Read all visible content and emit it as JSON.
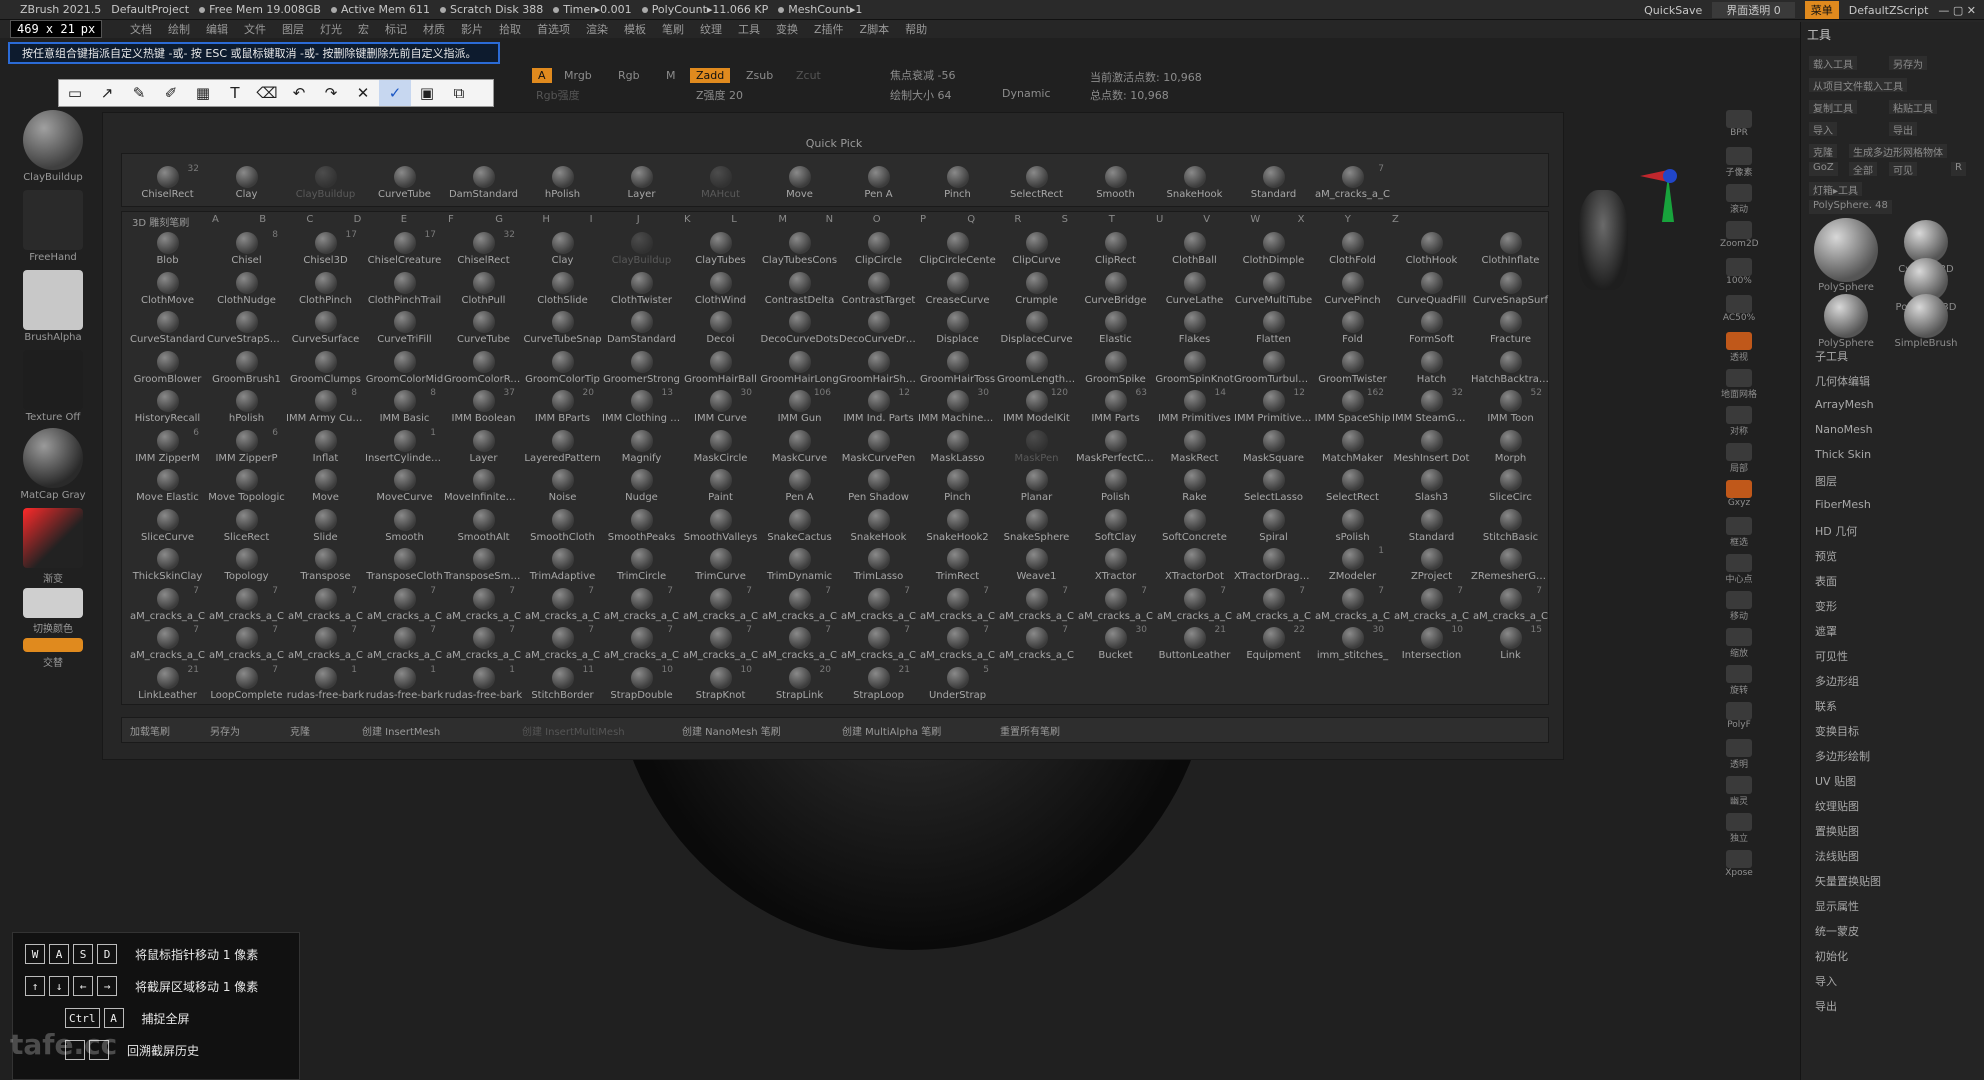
{
  "titlebar": {
    "app": "ZBrush 2021.5",
    "project": "DefaultProject",
    "stats": [
      "Free Mem 19.008GB",
      "Active Mem 611",
      "Scratch Disk 388",
      "Timer▸0.001",
      "PolyCount▸11.066 KP",
      "MeshCount▸1"
    ],
    "quicksave": "QuickSave",
    "transparency": "界面透明 0",
    "menu_btn": "菜单",
    "script": "DefaultZScript"
  },
  "menubar": {
    "items": [
      "文档",
      "绘制",
      "编辑",
      "文件",
      "图层",
      "灯光",
      "宏",
      "标记",
      "材质",
      "影片",
      "拾取",
      "首选项",
      "渲染",
      "模板",
      "笔刷",
      "纹理",
      "工具",
      "变换",
      "Z插件",
      "Z脚本",
      "帮助"
    ]
  },
  "size_readout": {
    "value": "469 x 21",
    "unit": "px"
  },
  "hint_bar": {
    "text": "按任意组合键指派自定义热键 -或- 按 ESC 或鼠标键取消 -或- 按删除键删除先前自定义指派。"
  },
  "snip_toolbar": {
    "buttons": [
      {
        "icon": "rectangle-icon",
        "glyph": "▭"
      },
      {
        "icon": "line-icon",
        "glyph": "↗"
      },
      {
        "icon": "pen-icon",
        "glyph": "✎"
      },
      {
        "icon": "highlighter-icon",
        "glyph": "✐"
      },
      {
        "icon": "mosaic-icon",
        "glyph": "▦"
      },
      {
        "icon": "text-icon",
        "glyph": "T"
      },
      {
        "icon": "eraser-icon",
        "glyph": "⌫"
      },
      {
        "icon": "undo-icon",
        "glyph": "↶"
      },
      {
        "icon": "redo-icon",
        "glyph": "↷"
      },
      {
        "icon": "close-icon",
        "glyph": "✕"
      },
      {
        "icon": "pin-icon",
        "glyph": "✓"
      },
      {
        "icon": "save-icon",
        "glyph": "▣"
      },
      {
        "icon": "copy-icon",
        "glyph": "⧉"
      }
    ]
  },
  "left_shelf": {
    "items": [
      "ClayBuildup",
      "FreeHand",
      "BrushAlpha",
      "Texture Off",
      "MatCap Gray",
      "渐变",
      "切换颜色",
      "交替"
    ]
  },
  "top_strip": {
    "a": "A",
    "mrgb": "Mrgb",
    "rgb": "Rgb",
    "m": "M",
    "zadd": "Zadd",
    "zsub": "Zsub",
    "zcut": "Zcut",
    "rgb_strength": "Rgb强度",
    "z_strength": "Z强度 20",
    "focal_label": "焦点衰减 -56",
    "draw_size": "绘制大小 64",
    "dynamic": "Dynamic",
    "active_points": "当前激活点数: 10,968",
    "total_points": "总点数: 10,968"
  },
  "brush_panel": {
    "quick_pick_title": "Quick Pick",
    "quick_pick": [
      {
        "name": "ChiselRect",
        "count": "32"
      },
      {
        "name": "Clay"
      },
      {
        "name": "ClayBuildup",
        "dim": true
      },
      {
        "name": "CurveTube"
      },
      {
        "name": "DamStandard"
      },
      {
        "name": "hPolish"
      },
      {
        "name": "Layer"
      },
      {
        "name": "MAHcut",
        "dim": true
      },
      {
        "name": "Move"
      },
      {
        "name": "Pen A"
      },
      {
        "name": "Pinch"
      },
      {
        "name": "SelectRect"
      },
      {
        "name": "Smooth"
      },
      {
        "name": "SnakeHook"
      },
      {
        "name": "Standard"
      },
      {
        "name": "aM_cracks_a_C",
        "count": "7"
      }
    ],
    "section_label": "3D 雕刻笔刷",
    "alphabet": [
      "A",
      "B",
      "C",
      "D",
      "E",
      "F",
      "G",
      "H",
      "I",
      "J",
      "K",
      "L",
      "M",
      "N",
      "O",
      "P",
      "Q",
      "R",
      "S",
      "T",
      "U",
      "V",
      "W",
      "X",
      "Y",
      "Z"
    ],
    "rows": [
      [
        {
          "name": "Blob"
        },
        {
          "name": "Chisel",
          "count": "8"
        },
        {
          "name": "Chisel3D",
          "count": "17"
        },
        {
          "name": "ChiselCreature",
          "count": "17"
        },
        {
          "name": "ChiselRect",
          "count": "32"
        },
        {
          "name": "Clay"
        },
        {
          "name": "ClayBuildup",
          "dim": true
        },
        {
          "name": "ClayTubes"
        },
        {
          "name": "ClayTubesCons"
        },
        {
          "name": "ClipCircle"
        },
        {
          "name": "ClipCircleCente"
        },
        {
          "name": "ClipCurve"
        },
        {
          "name": "ClipRect"
        },
        {
          "name": "ClothBall"
        },
        {
          "name": "ClothDimple"
        },
        {
          "name": "ClothFold"
        },
        {
          "name": "ClothHook"
        },
        {
          "name": "ClothInflate"
        }
      ],
      [
        {
          "name": "ClothMove"
        },
        {
          "name": "ClothNudge"
        },
        {
          "name": "ClothPinch"
        },
        {
          "name": "ClothPinchTrail"
        },
        {
          "name": "ClothPull"
        },
        {
          "name": "ClothSlide"
        },
        {
          "name": "ClothTwister"
        },
        {
          "name": "ClothWind"
        },
        {
          "name": "ContrastDelta"
        },
        {
          "name": "ContrastTarget"
        },
        {
          "name": "CreaseCurve"
        },
        {
          "name": "Crumple"
        },
        {
          "name": "CurveBridge"
        },
        {
          "name": "CurveLathe"
        },
        {
          "name": "CurveMultiTube"
        },
        {
          "name": "CurvePinch"
        },
        {
          "name": "CurveQuadFill"
        },
        {
          "name": "CurveSnapSurf"
        }
      ],
      [
        {
          "name": "CurveStandard"
        },
        {
          "name": "CurveStrapSnap"
        },
        {
          "name": "CurveSurface"
        },
        {
          "name": "CurveTriFill"
        },
        {
          "name": "CurveTube"
        },
        {
          "name": "CurveTubeSnap"
        },
        {
          "name": "DamStandard"
        },
        {
          "name": "Decoi"
        },
        {
          "name": "DecoCurveDots"
        },
        {
          "name": "DecoCurveDrag"
        },
        {
          "name": "Displace"
        },
        {
          "name": "DisplaceCurve"
        },
        {
          "name": "Elastic"
        },
        {
          "name": "Flakes"
        },
        {
          "name": "Flatten"
        },
        {
          "name": "Fold"
        },
        {
          "name": "FormSoft"
        },
        {
          "name": "Fracture"
        }
      ],
      [
        {
          "name": "GroomBlower"
        },
        {
          "name": "GroomBrush1"
        },
        {
          "name": "GroomClumps"
        },
        {
          "name": "GroomColorMid"
        },
        {
          "name": "GroomColorRoot"
        },
        {
          "name": "GroomColorTip"
        },
        {
          "name": "GroomerStrong"
        },
        {
          "name": "GroomHairBall"
        },
        {
          "name": "GroomHairLong"
        },
        {
          "name": "GroomHairShort"
        },
        {
          "name": "GroomHairToss"
        },
        {
          "name": "GroomLengthen"
        },
        {
          "name": "GroomSpike"
        },
        {
          "name": "GroomSpinKnot"
        },
        {
          "name": "GroomTurbulence"
        },
        {
          "name": "GroomTwister"
        },
        {
          "name": "Hatch"
        },
        {
          "name": "HatchBacktrack"
        }
      ],
      [
        {
          "name": "HistoryRecall"
        },
        {
          "name": "hPolish"
        },
        {
          "name": "IMM Army Curve",
          "count": "8"
        },
        {
          "name": "IMM Basic",
          "count": "8"
        },
        {
          "name": "IMM Boolean",
          "count": "37"
        },
        {
          "name": "IMM BParts",
          "count": "20"
        },
        {
          "name": "IMM Clothing HD",
          "count": "13"
        },
        {
          "name": "IMM Curve",
          "count": "30"
        },
        {
          "name": "IMM Gun",
          "count": "106"
        },
        {
          "name": "IMM Ind. Parts",
          "count": "12"
        },
        {
          "name": "IMM MachineParts",
          "count": "30"
        },
        {
          "name": "IMM ModelKit",
          "count": "120"
        },
        {
          "name": "IMM Parts",
          "count": "63"
        },
        {
          "name": "IMM Primitives",
          "count": "14"
        },
        {
          "name": "IMM PrimitivesHi",
          "count": "12"
        },
        {
          "name": "IMM SpaceShip",
          "count": "162"
        },
        {
          "name": "IMM SteamGears",
          "count": "32"
        },
        {
          "name": "IMM Toon",
          "count": "52"
        }
      ],
      [
        {
          "name": "IMM ZipperM",
          "count": "6"
        },
        {
          "name": "IMM ZipperP",
          "count": "6"
        },
        {
          "name": "Inflat"
        },
        {
          "name": "InsertCylinderExt",
          "count": "1"
        },
        {
          "name": "Layer"
        },
        {
          "name": "LayeredPattern"
        },
        {
          "name": "Magnify"
        },
        {
          "name": "MaskCircle"
        },
        {
          "name": "MaskCurve"
        },
        {
          "name": "MaskCurvePen"
        },
        {
          "name": "MaskLasso"
        },
        {
          "name": "MaskPen",
          "dim": true
        },
        {
          "name": "MaskPerfectCircle"
        },
        {
          "name": "MaskRect"
        },
        {
          "name": "MaskSquare"
        },
        {
          "name": "MatchMaker"
        },
        {
          "name": "MeshInsert Dot"
        },
        {
          "name": "Morph"
        }
      ],
      [
        {
          "name": "Move Elastic"
        },
        {
          "name": "Move Topologic"
        },
        {
          "name": "Move"
        },
        {
          "name": "MoveCurve"
        },
        {
          "name": "MoveInfiniteDepth"
        },
        {
          "name": "Noise"
        },
        {
          "name": "Nudge"
        },
        {
          "name": "Paint"
        },
        {
          "name": "Pen A"
        },
        {
          "name": "Pen Shadow"
        },
        {
          "name": "Pinch"
        },
        {
          "name": "Planar"
        },
        {
          "name": "Polish"
        },
        {
          "name": "Rake"
        },
        {
          "name": "SelectLasso"
        },
        {
          "name": "SelectRect"
        },
        {
          "name": "Slash3"
        },
        {
          "name": "SliceCirc"
        }
      ],
      [
        {
          "name": "SliceCurve"
        },
        {
          "name": "SliceRect"
        },
        {
          "name": "Slide"
        },
        {
          "name": "Smooth"
        },
        {
          "name": "SmoothAlt"
        },
        {
          "name": "SmoothCloth"
        },
        {
          "name": "SmoothPeaks"
        },
        {
          "name": "SmoothValleys"
        },
        {
          "name": "SnakeCactus"
        },
        {
          "name": "SnakeHook"
        },
        {
          "name": "SnakeHook2"
        },
        {
          "name": "SnakeSphere"
        },
        {
          "name": "SoftClay"
        },
        {
          "name": "SoftConcrete"
        },
        {
          "name": "Spiral"
        },
        {
          "name": "sPolish"
        },
        {
          "name": "Standard"
        },
        {
          "name": "StitchBasic"
        }
      ],
      [
        {
          "name": "ThickSkinClay"
        },
        {
          "name": "Topology"
        },
        {
          "name": "Transpose"
        },
        {
          "name": "TransposeCloth"
        },
        {
          "name": "TransposeSmart"
        },
        {
          "name": "TrimAdaptive"
        },
        {
          "name": "TrimCircle"
        },
        {
          "name": "TrimCurve"
        },
        {
          "name": "TrimDynamic"
        },
        {
          "name": "TrimLasso"
        },
        {
          "name": "TrimRect"
        },
        {
          "name": "Weave1"
        },
        {
          "name": "XTractor"
        },
        {
          "name": "XTractorDot"
        },
        {
          "name": "XTractorDragRect"
        },
        {
          "name": "ZModeler",
          "count": "1"
        },
        {
          "name": "ZProject"
        },
        {
          "name": "ZRemesherGuides"
        }
      ],
      [
        {
          "name": "aM_cracks_a_C",
          "count": "7"
        },
        {
          "name": "aM_cracks_a_C",
          "count": "7"
        },
        {
          "name": "aM_cracks_a_C",
          "count": "7"
        },
        {
          "name": "aM_cracks_a_C",
          "count": "7"
        },
        {
          "name": "aM_cracks_a_C",
          "count": "7"
        },
        {
          "name": "aM_cracks_a_C",
          "count": "7"
        },
        {
          "name": "aM_cracks_a_C",
          "count": "7"
        },
        {
          "name": "aM_cracks_a_C",
          "count": "7"
        },
        {
          "name": "aM_cracks_a_C",
          "count": "7"
        },
        {
          "name": "aM_cracks_a_C",
          "count": "7"
        },
        {
          "name": "aM_cracks_a_C",
          "count": "7"
        },
        {
          "name": "aM_cracks_a_C",
          "count": "7"
        },
        {
          "name": "aM_cracks_a_C",
          "count": "7"
        },
        {
          "name": "aM_cracks_a_C",
          "count": "7"
        },
        {
          "name": "aM_cracks_a_C",
          "count": "7"
        },
        {
          "name": "aM_cracks_a_C",
          "count": "7"
        },
        {
          "name": "aM_cracks_a_C",
          "count": "7"
        },
        {
          "name": "aM_cracks_a_C",
          "count": "7"
        }
      ],
      [
        {
          "name": "aM_cracks_a_C",
          "count": "7"
        },
        {
          "name": "aM_cracks_a_C",
          "count": "7"
        },
        {
          "name": "aM_cracks_a_C",
          "count": "7"
        },
        {
          "name": "aM_cracks_a_C",
          "count": "7"
        },
        {
          "name": "aM_cracks_a_C",
          "count": "7"
        },
        {
          "name": "aM_cracks_a_C",
          "count": "7"
        },
        {
          "name": "aM_cracks_a_C",
          "count": "7"
        },
        {
          "name": "aM_cracks_a_C",
          "count": "7"
        },
        {
          "name": "aM_cracks_a_C",
          "count": "7"
        },
        {
          "name": "aM_cracks_a_C",
          "count": "7"
        },
        {
          "name": "aM_cracks_a_C",
          "count": "7"
        },
        {
          "name": "aM_cracks_a_C",
          "count": "7"
        },
        {
          "name": "Bucket",
          "count": "30"
        },
        {
          "name": "ButtonLeather",
          "count": "21"
        },
        {
          "name": "Equipment",
          "count": "22"
        },
        {
          "name": "imm_stitches_",
          "count": "30"
        },
        {
          "name": "Intersection",
          "count": "10"
        },
        {
          "name": "Link",
          "count": "15"
        }
      ],
      [
        {
          "name": "LinkLeather",
          "count": "21"
        },
        {
          "name": "LoopComplete",
          "count": "7"
        },
        {
          "name": "rudas-free-bark",
          "count": "1"
        },
        {
          "name": "rudas-free-bark",
          "count": "1"
        },
        {
          "name": "rudas-free-bark",
          "count": "1"
        },
        {
          "name": "StitchBorder",
          "count": "11"
        },
        {
          "name": "StrapDouble",
          "count": "10"
        },
        {
          "name": "StrapKnot",
          "count": "10"
        },
        {
          "name": "StrapLink",
          "count": "20"
        },
        {
          "name": "StrapLoop",
          "count": "21"
        },
        {
          "name": "UnderStrap",
          "count": "5"
        }
      ]
    ],
    "bottom_actions": [
      "加载笔刷",
      "另存为",
      "克隆",
      "创建 InsertMesh",
      "创建 InsertMultiMesh",
      "创建 NanoMesh 笔刷",
      "创建 MultiAlpha 笔刷",
      "重置所有笔刷"
    ]
  },
  "right_toolbar": {
    "items": [
      "BPR",
      "子像素",
      "滚动",
      "Zoom2D",
      "100%",
      "AC50%",
      "透视",
      "地面网格",
      "对称",
      "局部",
      "Gxyz",
      "框选",
      "中心点",
      "移动",
      "缩放",
      "旋转",
      "PolyF",
      "透明",
      "幽灵",
      "独立",
      "Xpose"
    ]
  },
  "tool_palette": {
    "title": "工具",
    "buttons": [
      "载入工具",
      "另存为",
      "从项目文件载入工具",
      "复制工具",
      "粘贴工具",
      "导入",
      "导出",
      "克隆",
      "生成多边形网格物体",
      "GoZ",
      "全部",
      "可见",
      "R",
      "灯箱▸工具"
    ],
    "polysphere": "PolySphere. 48",
    "thumbs": [
      "PolySphere",
      "Cylinder3D",
      "PolyMesh3D",
      "PolySphere",
      "SimpleBrush"
    ],
    "sections": [
      "子工具",
      "几何体编辑",
      "ArrayMesh",
      "NanoMesh",
      "Thick Skin",
      "图层",
      "FiberMesh",
      "HD 几何",
      "预览",
      "表面",
      "变形",
      "遮罩",
      "可见性",
      "多边形组",
      "联系",
      "变换目标",
      "多边形绘制",
      "UV 贴图",
      "纹理贴图",
      "置换贴图",
      "法线贴图",
      "矢量置换贴图",
      "显示属性",
      "统一蒙皮",
      "初始化",
      "导入",
      "导出"
    ]
  },
  "shortcuts": {
    "rows": [
      {
        "keys": [
          "W",
          "A",
          "S",
          "D"
        ],
        "text": "将鼠标指针移动 1 像素"
      },
      {
        "keys": [
          "↑",
          "↓",
          "←",
          "→"
        ],
        "text": "将截屏区域移动 1 像素"
      },
      {
        "keys": [
          "Ctrl",
          "A"
        ],
        "text": "捕捉全屏"
      },
      {
        "keys": [
          "",
          ""
        ],
        "text": "回溯截屏历史"
      }
    ]
  },
  "watermark": "tafe.cc"
}
